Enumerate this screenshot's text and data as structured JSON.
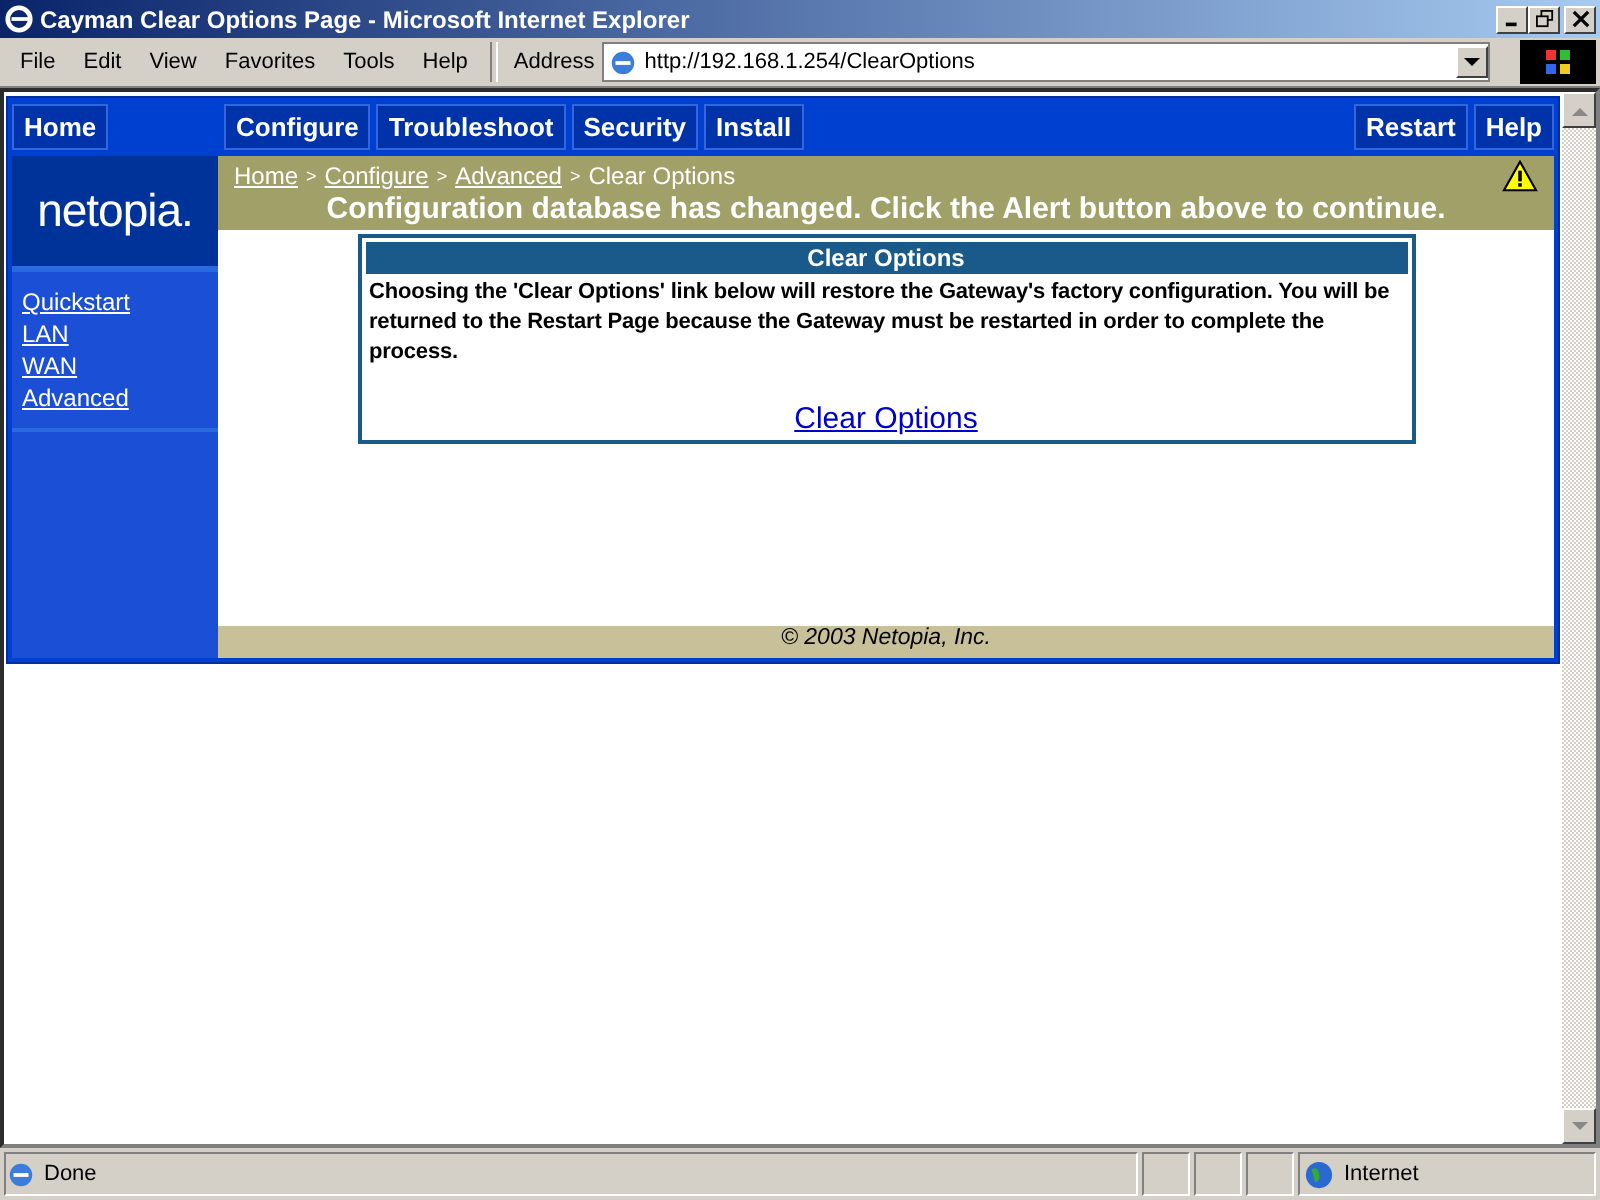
{
  "window": {
    "title": "Cayman Clear Options Page - Microsoft Internet Explorer"
  },
  "menu": [
    "File",
    "Edit",
    "View",
    "Favorites",
    "Tools",
    "Help"
  ],
  "address": {
    "label": "Address",
    "value": "http://192.168.1.254/ClearOptions"
  },
  "nav": {
    "left": [
      "Home"
    ],
    "middle": [
      "Configure",
      "Troubleshoot",
      "Security",
      "Install"
    ],
    "right": [
      "Restart",
      "Help"
    ]
  },
  "logo": "netopia.",
  "sidebar": {
    "items": [
      "Quickstart",
      "LAN",
      "WAN",
      "Advanced"
    ]
  },
  "breadcrumb": {
    "links": [
      "Home",
      "Configure",
      "Advanced"
    ],
    "separator": ">",
    "current": "Clear Options"
  },
  "alert": "Configuration database has changed. Click the Alert button above to continue.",
  "panel": {
    "title": "Clear Options",
    "text": "Choosing the 'Clear Options' link below will restore the Gateway's factory configuration. You will be returned to the Restart Page because the Gateway must be restarted in order to complete the process.",
    "link": "Clear Options"
  },
  "footer": "© 2003 Netopia, Inc.",
  "status_bar": {
    "text": "Done",
    "zone": "Internet"
  }
}
